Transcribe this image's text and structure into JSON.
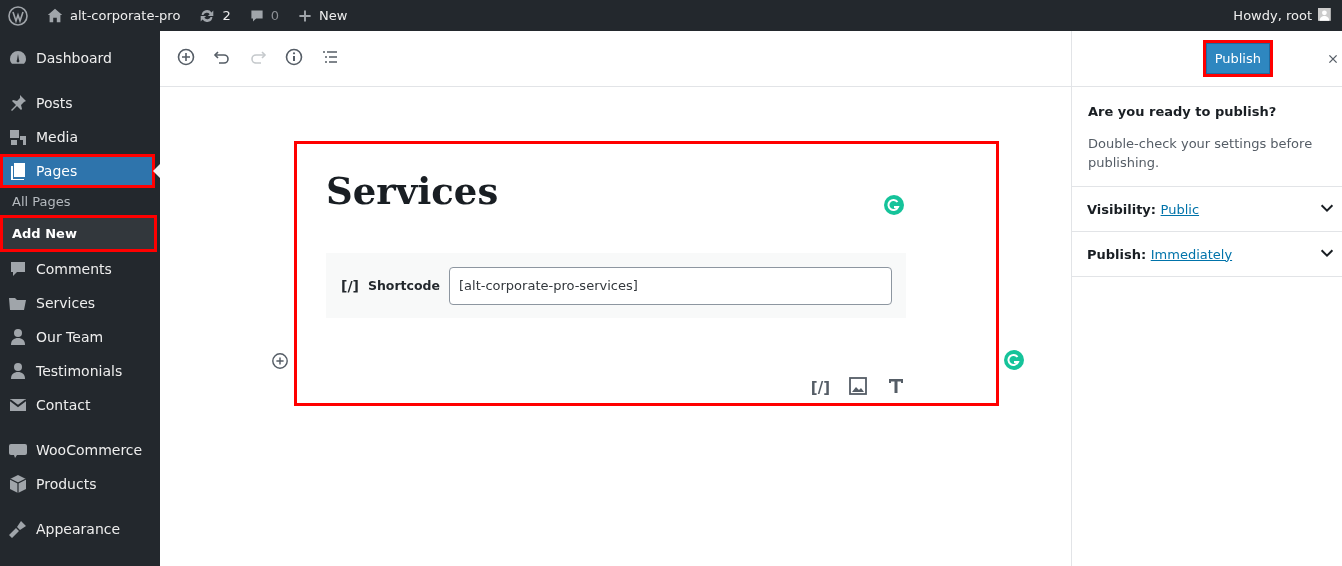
{
  "admin_bar": {
    "site": "alt-corporate-pro",
    "updates": "2",
    "comments": "0",
    "new": "New",
    "greeting": "Howdy, root"
  },
  "sidebar": {
    "items": [
      {
        "kind": "item",
        "label": "Dashboard",
        "current": false,
        "highlighted": false
      },
      {
        "kind": "separator"
      },
      {
        "kind": "item",
        "label": "Posts",
        "current": false,
        "highlighted": false
      },
      {
        "kind": "item",
        "label": "Media",
        "current": false,
        "highlighted": false
      },
      {
        "kind": "item",
        "label": "Pages",
        "current": true,
        "highlighted": true
      },
      {
        "kind": "subitem",
        "label": "All Pages",
        "current": false,
        "highlighted": false
      },
      {
        "kind": "subitem",
        "label": "Add New",
        "current": true,
        "highlighted": true
      },
      {
        "kind": "item",
        "label": "Comments",
        "current": false,
        "highlighted": false
      },
      {
        "kind": "item",
        "label": "Services",
        "current": false,
        "highlighted": false
      },
      {
        "kind": "item",
        "label": "Our Team",
        "current": false,
        "highlighted": false
      },
      {
        "kind": "item",
        "label": "Testimonials",
        "current": false,
        "highlighted": false
      },
      {
        "kind": "item",
        "label": "Contact",
        "current": false,
        "highlighted": false
      },
      {
        "kind": "separator"
      },
      {
        "kind": "item",
        "label": "WooCommerce",
        "current": false,
        "highlighted": false
      },
      {
        "kind": "item",
        "label": "Products",
        "current": false,
        "highlighted": false
      },
      {
        "kind": "separator"
      },
      {
        "kind": "item",
        "label": "Appearance",
        "current": false,
        "highlighted": false
      }
    ]
  },
  "toolbar": [
    {
      "kind": "add",
      "disabled": false
    },
    {
      "kind": "undo",
      "disabled": false
    },
    {
      "kind": "redo",
      "disabled": true
    },
    {
      "kind": "info",
      "disabled": false
    },
    {
      "kind": "outline",
      "disabled": false
    }
  ],
  "editor": {
    "highlighted": true,
    "title": "Services",
    "block": {
      "icon": "[/]",
      "label": "Shortcode",
      "value": "[alt-corporate-pro-services]"
    },
    "block_tools": [
      {
        "kind": "shortcode",
        "label": "[/]"
      },
      {
        "kind": "image"
      },
      {
        "kind": "text"
      }
    ]
  },
  "publish_panel": {
    "button": "Publish",
    "button_highlighted": true,
    "heading": "Are you ready to publish?",
    "description": "Double-check your settings before publishing.",
    "rows": [
      {
        "label": "Visibility:",
        "value": "Public",
        "expanded": false
      },
      {
        "label": "Publish:",
        "value": "Immediately",
        "expanded": false
      }
    ]
  }
}
